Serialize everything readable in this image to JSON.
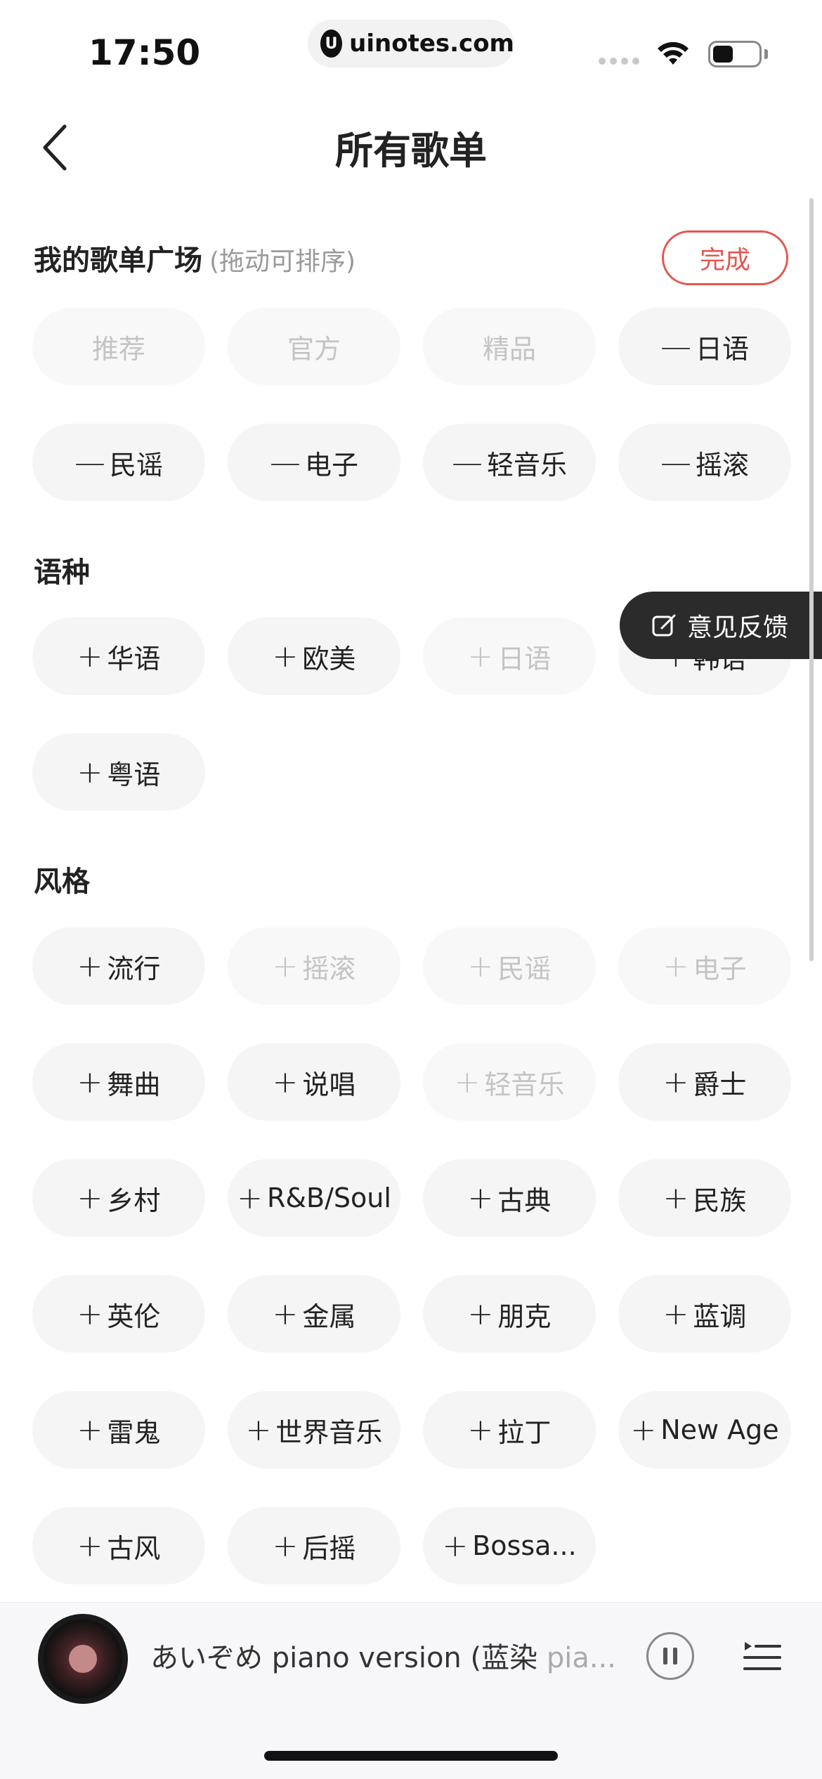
{
  "status": {
    "time": "17:50",
    "url": "uinotes.com"
  },
  "nav": {
    "title": "所有歌单"
  },
  "my_section": {
    "title": "我的歌单广场",
    "hint": "(拖动可排序)",
    "done_label": "完成",
    "chips": [
      {
        "label": "推荐",
        "sym": "",
        "dim": true
      },
      {
        "label": "官方",
        "sym": "",
        "dim": true
      },
      {
        "label": "精品",
        "sym": "",
        "dim": true
      },
      {
        "label": "日语",
        "sym": "—",
        "dim": false
      },
      {
        "label": "民谣",
        "sym": "—",
        "dim": false
      },
      {
        "label": "电子",
        "sym": "—",
        "dim": false
      },
      {
        "label": "轻音乐",
        "sym": "—",
        "dim": false
      },
      {
        "label": "摇滚",
        "sym": "—",
        "dim": false
      }
    ]
  },
  "lang_section": {
    "title": "语种",
    "chips": [
      {
        "label": "华语",
        "sym": "+",
        "dim": false
      },
      {
        "label": "欧美",
        "sym": "+",
        "dim": false
      },
      {
        "label": "日语",
        "sym": "+",
        "dim": true
      },
      {
        "label": "韩语",
        "sym": "+",
        "dim": false
      },
      {
        "label": "粤语",
        "sym": "+",
        "dim": false
      }
    ]
  },
  "style_section": {
    "title": "风格",
    "chips": [
      {
        "label": "流行",
        "sym": "+",
        "dim": false
      },
      {
        "label": "摇滚",
        "sym": "+",
        "dim": true
      },
      {
        "label": "民谣",
        "sym": "+",
        "dim": true
      },
      {
        "label": "电子",
        "sym": "+",
        "dim": true
      },
      {
        "label": "舞曲",
        "sym": "+",
        "dim": false
      },
      {
        "label": "说唱",
        "sym": "+",
        "dim": false
      },
      {
        "label": "轻音乐",
        "sym": "+",
        "dim": true
      },
      {
        "label": "爵士",
        "sym": "+",
        "dim": false
      },
      {
        "label": "乡村",
        "sym": "+",
        "dim": false
      },
      {
        "label": "R&B/Soul",
        "sym": "+",
        "dim": false
      },
      {
        "label": "古典",
        "sym": "+",
        "dim": false
      },
      {
        "label": "民族",
        "sym": "+",
        "dim": false
      },
      {
        "label": "英伦",
        "sym": "+",
        "dim": false
      },
      {
        "label": "金属",
        "sym": "+",
        "dim": false
      },
      {
        "label": "朋克",
        "sym": "+",
        "dim": false
      },
      {
        "label": "蓝调",
        "sym": "+",
        "dim": false
      },
      {
        "label": "雷鬼",
        "sym": "+",
        "dim": false
      },
      {
        "label": "世界音乐",
        "sym": "+",
        "dim": false
      },
      {
        "label": "拉丁",
        "sym": "+",
        "dim": false
      },
      {
        "label": "New Age",
        "sym": "+",
        "dim": false
      },
      {
        "label": "古风",
        "sym": "+",
        "dim": false
      },
      {
        "label": "后摇",
        "sym": "+",
        "dim": false
      },
      {
        "label": "Bossa...",
        "sym": "+",
        "dim": false
      }
    ]
  },
  "feedback": {
    "label": "意见反馈"
  },
  "player": {
    "song_main": "あいぞめ piano version (蓝染 ",
    "song_fade": "pia..."
  },
  "colors": {
    "accent": "#e4574f",
    "chip_bg": "#f5f5f5",
    "dim_text": "#c4c4c4"
  }
}
